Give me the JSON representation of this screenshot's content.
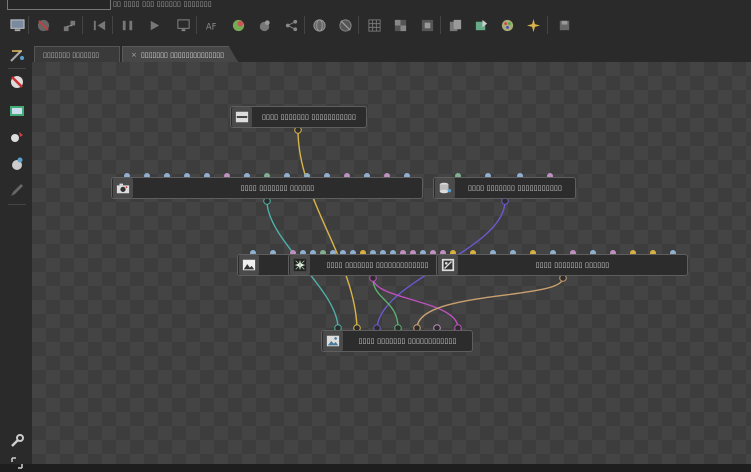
{
  "window": {
    "title_field": "",
    "title_text": "▯▯ ▯▯▯▯ ▯▯▯ ▯▯▯▯▯▯ ▯▯▯▯▯▯▯"
  },
  "toolbar": {
    "icons": [
      "monitor-icon",
      "no-cache-icon",
      "network-icon",
      "skip-back-icon",
      "pause-icon",
      "play-icon",
      "display-icon",
      "text-af-icon",
      "sphere-color-icon",
      "sphere-gear-icon",
      "node-tree-icon",
      "globe-icon",
      "globe-off-icon",
      "grid-icon",
      "checker-icon",
      "checker-alt-icon",
      "copy-icon",
      "export-icon",
      "palette-icon",
      "sparkle-icon",
      "save-icon"
    ]
  },
  "sidebar": {
    "icons": [
      "tool-wand-icon",
      "no-cache-icon",
      "render-icon",
      "light-bulb-icon",
      "material-sphere-icon",
      "pen-icon",
      "wrench-icon",
      "expand-icon"
    ]
  },
  "tabs": [
    {
      "label": "▯▯▯▯▯▯▯ ▯▯▯▯▯▯▯",
      "active": false
    },
    {
      "label": "▯▯▯▯▯▯▯ ▯▯▯▯▯▯▯▯▯▯▯▯▯▯",
      "active": true,
      "close": "×"
    }
  ],
  "nodes": [
    {
      "id": "n-top",
      "label": "▯▯▯▯ ▯▯▯▯▯▯▯ ▯▯▯▯▯▯▯▯▯▯▯",
      "icon": "display-icon"
    },
    {
      "id": "n-camera",
      "label": "▯▯▯▯ ▯▯▯▯▯▯▯ ▯▯▯▯▯▯",
      "icon": "camera-icon"
    },
    {
      "id": "n-db",
      "label": "▯▯▯▯ ▯▯▯▯▯▯▯ ▯▯▯▯▯▯▯▯▯▯▯",
      "icon": "database-icon"
    },
    {
      "id": "n-image",
      "label": "",
      "icon": "image-icon"
    },
    {
      "id": "n-star",
      "label": "▯▯▯▯ ▯▯▯▯▯▯▯ ▯▯▯▯▯▯▯▯▯▯▯▯▯",
      "icon": "star-burst-icon"
    },
    {
      "id": "n-filter",
      "label": "▯▯▯▯ ▯▯▯▯▯▯▯ ▯▯▯▯▯▯",
      "icon": "filter-icon"
    },
    {
      "id": "n-render",
      "label": "▯▯▯▯ ▯▯▯▯▯▯▯ ▯▯▯▯▯▯▯▯▯▯▯▯",
      "icon": "render-target-icon"
    }
  ],
  "colors": {
    "wire_yellow": "#d8b44a",
    "wire_teal": "#4fb0a8",
    "wire_purple": "#6a5ad0",
    "wire_magenta": "#c050c0",
    "wire_green": "#5cb070",
    "wire_tan": "#c8a070",
    "port_blue": "#8fb0d0",
    "port_pink": "#c090c0",
    "port_green": "#80b090",
    "port_yellow": "#d8b040"
  }
}
